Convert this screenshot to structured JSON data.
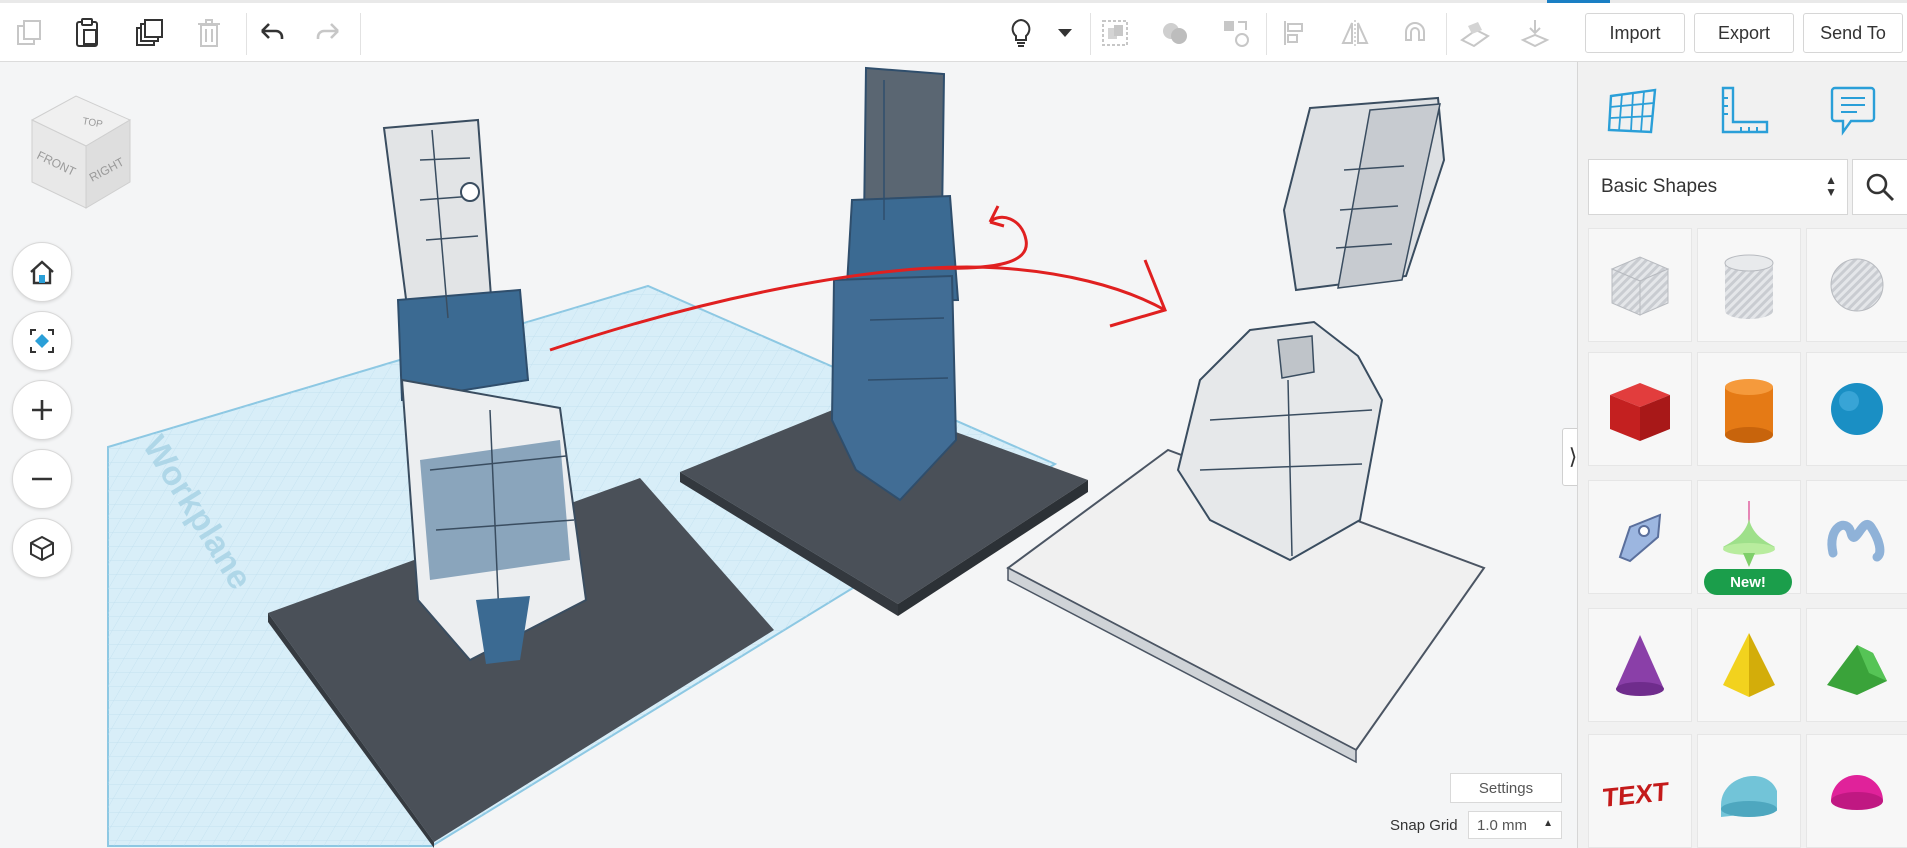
{
  "toolbar": {
    "import_label": "Import",
    "export_label": "Export",
    "send_to_label": "Send To"
  },
  "viewport": {
    "workplane_label": "Workplane",
    "viewcube": {
      "top": "TOP",
      "front": "FRONT",
      "right": "RIGHT"
    },
    "settings_label": "Settings",
    "snap_grid_label": "Snap Grid",
    "snap_grid_value": "1.0 mm"
  },
  "panel": {
    "shape_category": "Basic Shapes",
    "new_badge": "New!",
    "text_shape_label": "TEXT",
    "shapes": [
      "box-striped",
      "cylinder-striped",
      "sphere-striped",
      "box",
      "cylinder",
      "sphere",
      "scribble",
      "paraboloid",
      "torus-knot",
      "cone",
      "pyramid",
      "wedge",
      "text",
      "half-cylinder",
      "half-sphere"
    ]
  },
  "colors": {
    "accent": "#1a7fc4",
    "panel_icon": "#2a9fd8",
    "new_badge": "#1b9e4b",
    "annotation": "#e02020"
  }
}
